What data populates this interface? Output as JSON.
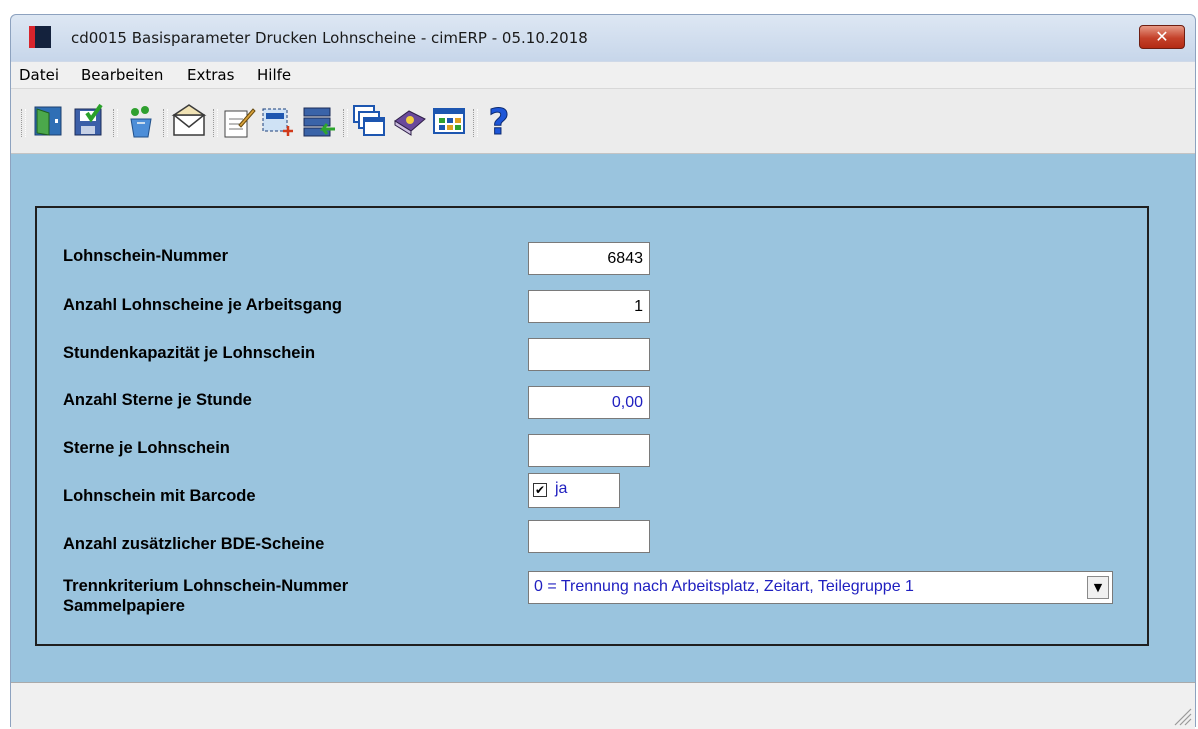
{
  "window": {
    "title": "cd0015 Basisparameter Drucken Lohnscheine - cimERP - 05.10.2018",
    "close_label": "✕"
  },
  "menu": [
    "Datei",
    "Bearbeiten",
    "Extras",
    "Hilfe"
  ],
  "toolbar": {
    "buttons": [
      "exit-icon",
      "save-icon",
      "recycle-icon",
      "mail-icon",
      "edit-document-icon",
      "select-area-icon",
      "transfer-icon",
      "windows-icon",
      "book-icon",
      "table-icon",
      "help-icon"
    ],
    "help_glyph": "?"
  },
  "form": {
    "fields": [
      {
        "label": "Lohnschein-Nummer",
        "value": "6843"
      },
      {
        "label": "Anzahl Lohnscheine je Arbeitsgang",
        "value": "1"
      },
      {
        "label": "Stundenkapazität je Lohnschein",
        "value": ""
      },
      {
        "label": "Anzahl Sterne je Stunde",
        "value": "0,00"
      },
      {
        "label": "Sterne je Lohnschein",
        "value": ""
      },
      {
        "label": "Lohnschein mit Barcode",
        "checked": true,
        "checkbox_text": "ja"
      },
      {
        "label": "Anzahl zusätzlicher BDE-Scheine",
        "value": ""
      },
      {
        "label": "Trennkriterium Lohnschein-Nummer",
        "label_line2": "Sammelpapiere",
        "selected": "0 = Trennung nach Arbeitsplatz, Zeitart, Teilegruppe 1"
      }
    ],
    "check_mark": "✔",
    "dropdown_arrow": "▼"
  },
  "colors": {
    "client_bg": "#9ac4de",
    "value_text": "#2020c0",
    "close_button": "#c4412a"
  }
}
